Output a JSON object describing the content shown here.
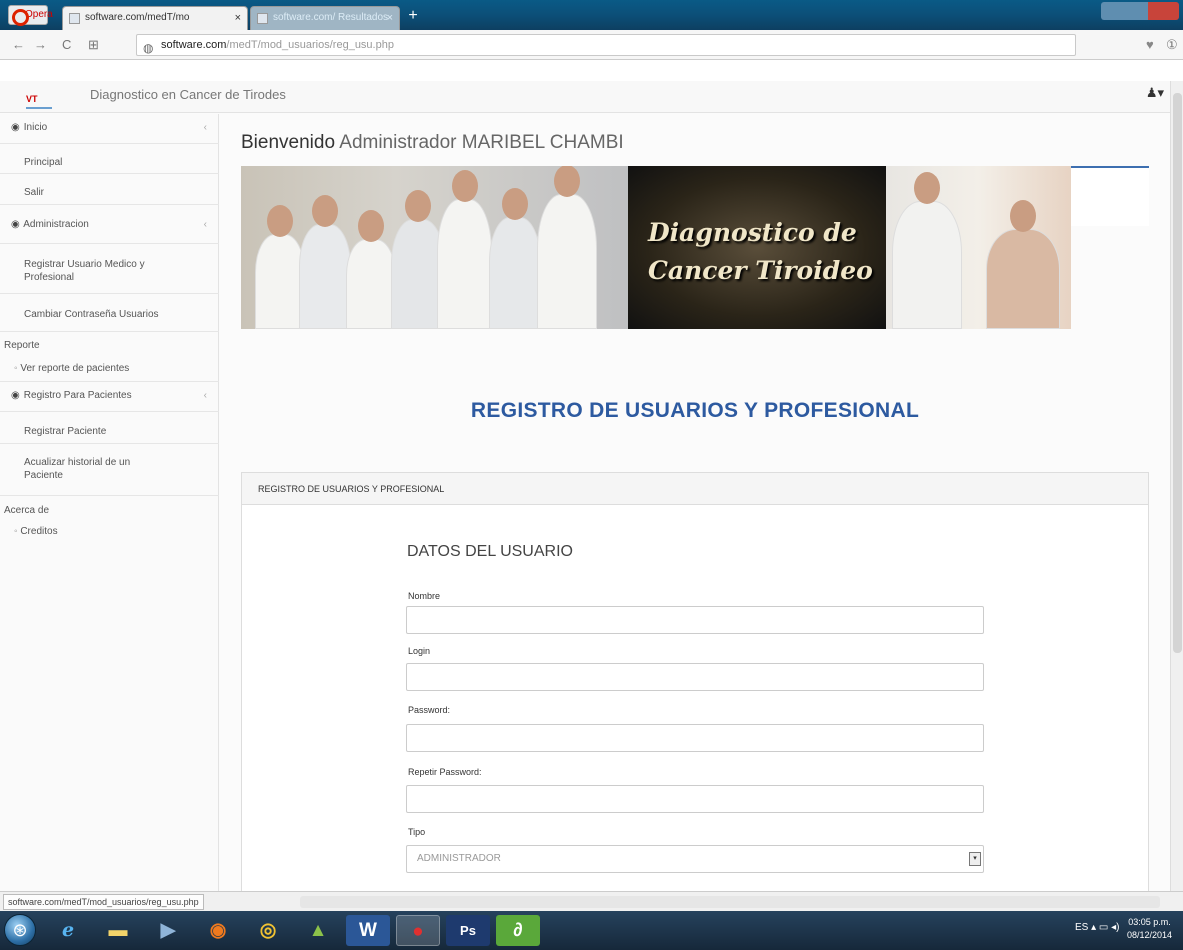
{
  "browser": {
    "opera_label": "Opera",
    "tabs": [
      {
        "title": "software.com/medT/mo"
      },
      {
        "title": "software.com/ Resultados"
      }
    ],
    "new_tab": "+",
    "url_host": "software.com",
    "url_path": "/medT/mod_usuarios/reg_usu.php"
  },
  "app": {
    "brand": "Diagnostico en Cancer de Tirodes",
    "logo_text": "VT"
  },
  "sidebar": {
    "groups": [
      {
        "label": "Inicio",
        "items": [
          "Principal",
          "Salir"
        ]
      },
      {
        "label": "Administracion",
        "items": [
          "Registrar Usuario Medico y Profesional",
          "Cambiar Contraseña Usuarios"
        ]
      },
      {
        "label": "Reporte",
        "items": [
          "Ver reporte de pacientes"
        ]
      },
      {
        "label": "Registro Para Pacientes",
        "items": [
          "Registrar Paciente",
          "Acualizar historial de un Paciente"
        ]
      },
      {
        "label": "Acerca de",
        "items": [
          "Creditos"
        ]
      }
    ]
  },
  "main": {
    "welcome_prefix": "Bienvenido",
    "welcome_role": "Administrador",
    "welcome_name": "MARIBEL CHAMBI",
    "banner_line1": "Diagnostico de",
    "banner_line2": "Cancer Tiroideo",
    "page_title": "REGISTRO DE USUARIOS Y PROFESIONAL",
    "panel_heading": "REGISTRO DE USUARIOS Y PROFESIONAL",
    "section_title": "DATOS DEL USUARIO",
    "fields": {
      "nombre_label": "Nombre",
      "login_label": "Login",
      "password_label": "Password:",
      "repeat_password_label": "Repetir Password:",
      "tipo_label": "Tipo",
      "tipo_value": "ADMINISTRADOR"
    }
  },
  "status": {
    "url": "software.com/medT/mod_usuarios/reg_usu.php"
  },
  "taskbar": {
    "tray_lang": "ES",
    "time": "03:05 p.m.",
    "date": "08/12/2014"
  }
}
